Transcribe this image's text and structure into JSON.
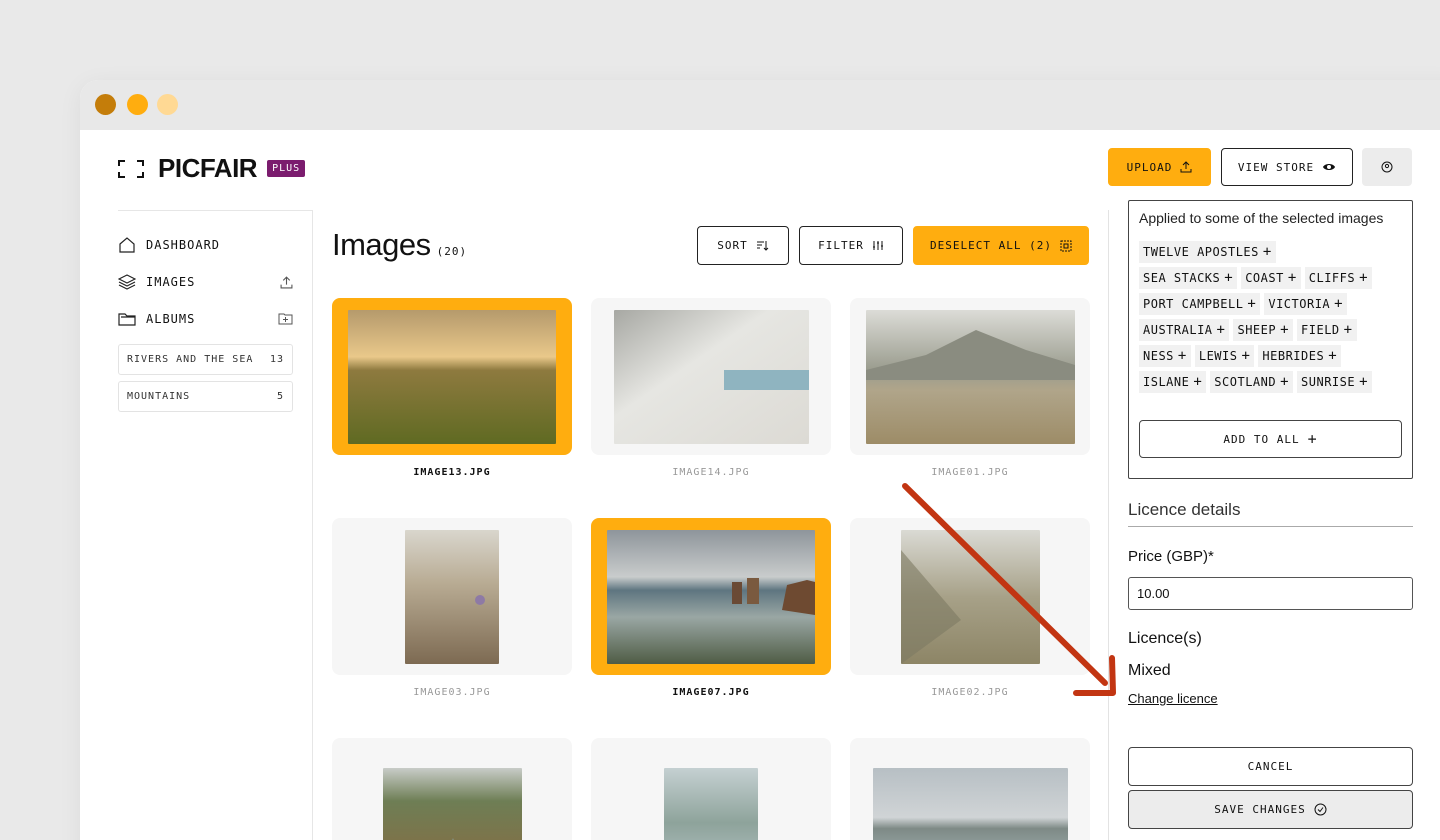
{
  "window": {
    "dots": [
      "#c47d0a",
      "#ffad0f",
      "#ffd994"
    ]
  },
  "header": {
    "logo": "PICFAIR",
    "plan_badge": "PLUS",
    "upload_label": "UPLOAD",
    "view_store_label": "VIEW STORE"
  },
  "sidebar": {
    "nav": [
      {
        "label": "DASHBOARD",
        "icon": "home-icon"
      },
      {
        "label": "IMAGES",
        "icon": "layers-icon"
      },
      {
        "label": "ALBUMS",
        "icon": "folder-icon"
      }
    ],
    "albums": [
      {
        "name": "RIVERS AND THE SEA",
        "count": "13"
      },
      {
        "name": "MOUNTAINS",
        "count": "5"
      }
    ]
  },
  "main": {
    "title": "Images",
    "count": "(20)",
    "sort_label": "SORT",
    "filter_label": "FILTER",
    "deselect_label": "DESELECT ALL (2)",
    "images": [
      {
        "name": "IMAGE13.JPG",
        "selected": true
      },
      {
        "name": "IMAGE14.JPG",
        "selected": false
      },
      {
        "name": "IMAGE01.JPG",
        "selected": false
      },
      {
        "name": "IMAGE03.JPG",
        "selected": false
      },
      {
        "name": "IMAGE07.JPG",
        "selected": true
      },
      {
        "name": "IMAGE02.JPG",
        "selected": false
      }
    ]
  },
  "panel": {
    "applied_note": "Applied to some of the selected images",
    "tag_rows": [
      [
        "TWELVE APOSTLES"
      ],
      [
        "SEA STACKS",
        "COAST",
        "CLIFFS"
      ],
      [
        "PORT CAMPBELL",
        "VICTORIA"
      ],
      [
        "AUSTRALIA",
        "SHEEP",
        "FIELD"
      ],
      [
        "NESS",
        "LEWIS",
        "HEBRIDES"
      ],
      [
        "ISLANE",
        "SCOTLAND",
        "SUNRISE"
      ]
    ],
    "add_to_all_label": "ADD TO ALL",
    "licence_section_title": "Licence details",
    "price_label": "Price (GBP)*",
    "price_value": "10.00",
    "licences_label": "Licence(s)",
    "licences_value": "Mixed",
    "change_licence_link": "Change licence",
    "cancel_label": "CANCEL",
    "save_label": "SAVE CHANGES"
  },
  "colors": {
    "accent": "#ffad0f",
    "badge": "#7b1c6e",
    "arrow": "#c23512"
  }
}
